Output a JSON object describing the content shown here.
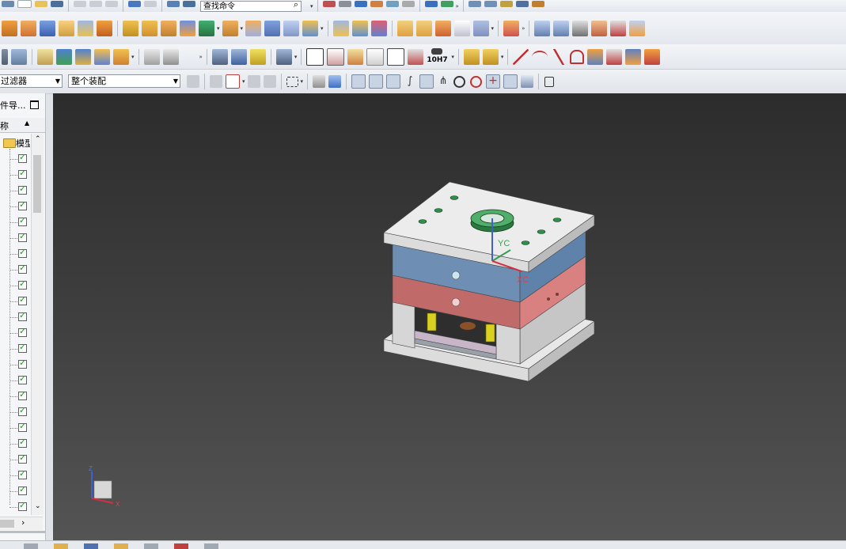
{
  "toolbar": {
    "search_placeholder": "查找命令",
    "selection_filter": "过滤器",
    "selection_scope": "整个装配",
    "tolerance_label": "10H7"
  },
  "navigator": {
    "title": "件导...",
    "column_name": "称",
    "root_label": "模型",
    "checked_rows": 23
  },
  "viewport": {
    "axis_labels": {
      "yc": "YC",
      "xc": "XC"
    },
    "triad_labels": {
      "z": "Z",
      "x": "X"
    }
  },
  "colors": {
    "viewport_top": "#2c2c2c",
    "viewport_bottom": "#545454",
    "plate_white": "#e8e8e8",
    "plate_blue": "#6e8fb3",
    "plate_red": "#c06a6a",
    "pin_yellow": "#d9d020",
    "ring_green": "#2f8f4a"
  }
}
